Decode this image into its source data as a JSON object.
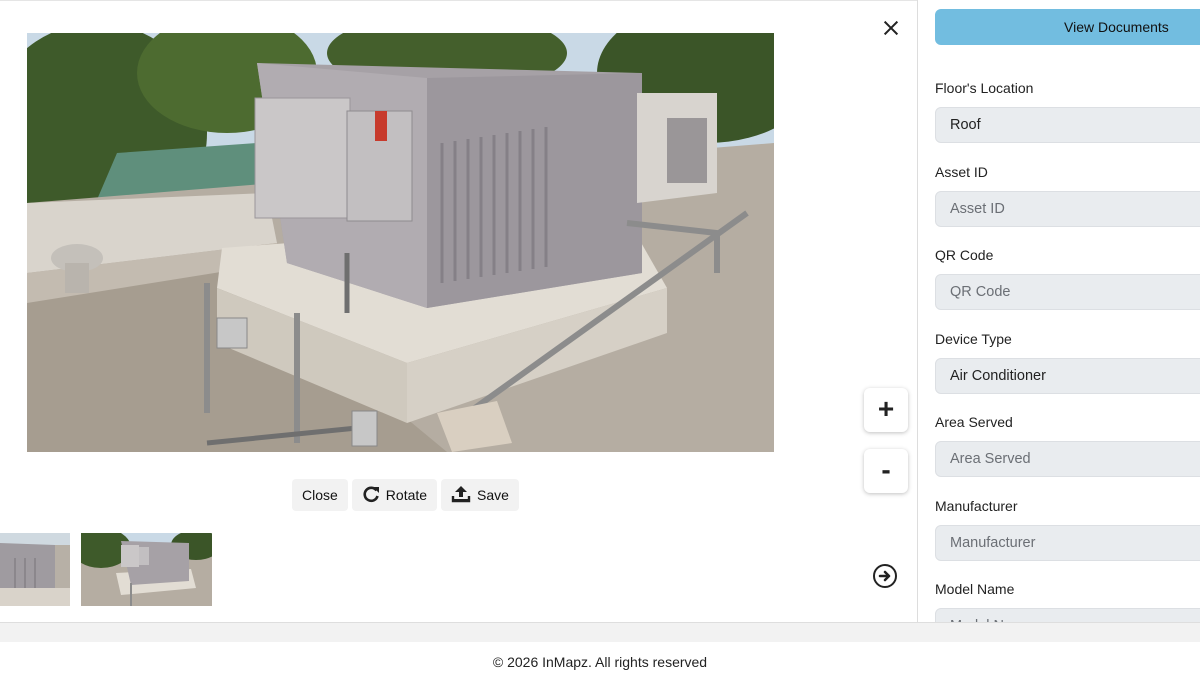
{
  "viewer": {
    "close_icon": "close-icon",
    "zoom_in_label": "+",
    "zoom_out_label": "-",
    "next_icon": "arrow-circle-right-icon",
    "toolbar": {
      "close_label": "Close",
      "rotate_label": "Rotate",
      "rotate_icon": "rotate-icon",
      "save_label": "Save",
      "save_icon": "upload-icon"
    }
  },
  "panel": {
    "view_documents_label": "View Documents",
    "fields": [
      {
        "label": "Floor's Location",
        "value": "Roof",
        "placeholder": ""
      },
      {
        "label": "Asset ID",
        "value": "",
        "placeholder": "Asset ID"
      },
      {
        "label": "QR Code",
        "value": "",
        "placeholder": "QR Code"
      },
      {
        "label": "Device Type",
        "value": "Air Conditioner",
        "placeholder": ""
      },
      {
        "label": "Area Served",
        "value": "",
        "placeholder": "Area Served"
      },
      {
        "label": "Manufacturer",
        "value": "",
        "placeholder": "Manufacturer"
      },
      {
        "label": "Model Name",
        "value": "",
        "placeholder": "Model Name"
      }
    ]
  },
  "footer": {
    "text": "© 2026 InMapz. All rights reserved"
  },
  "colors": {
    "accent": "#72bde0",
    "input_bg": "#e9ecef",
    "button_bg": "#f2f2f2"
  }
}
